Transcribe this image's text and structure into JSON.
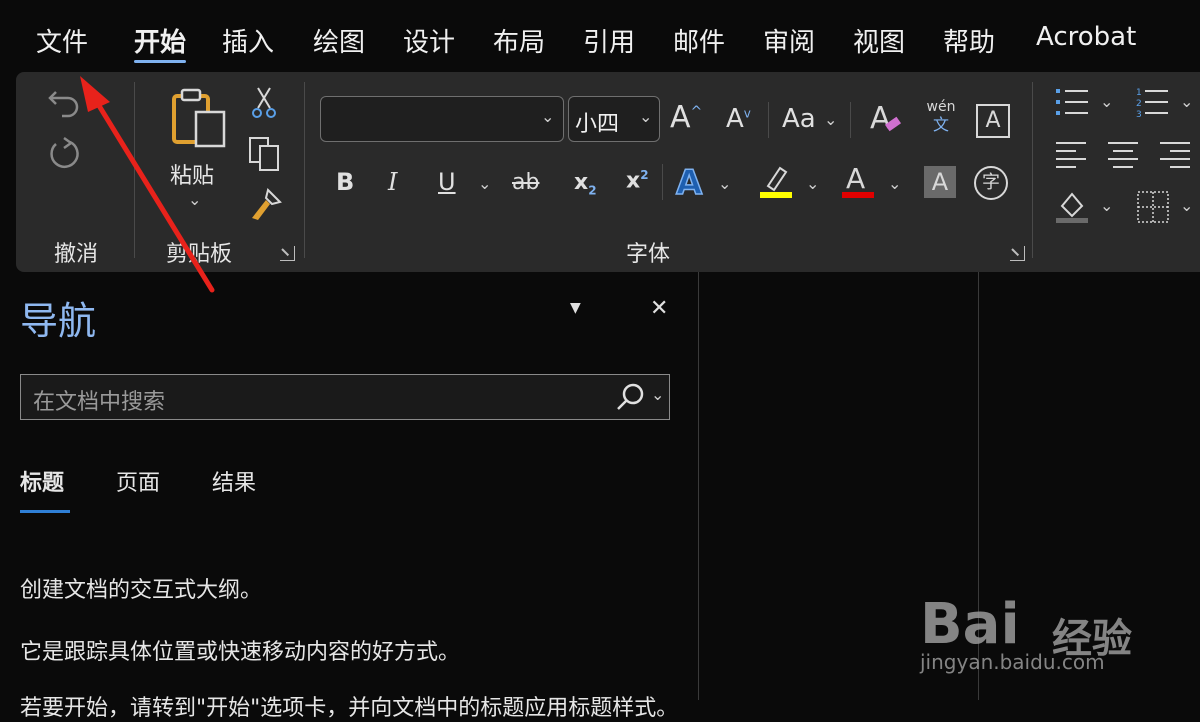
{
  "menu": {
    "tabs": [
      "文件",
      "开始",
      "插入",
      "绘图",
      "设计",
      "布局",
      "引用",
      "邮件",
      "审阅",
      "视图",
      "帮助",
      "Acrobat"
    ],
    "active_index": 1
  },
  "ribbon": {
    "groups": {
      "undo": {
        "label": "撤消"
      },
      "clipboard": {
        "label": "剪贴板",
        "paste_label": "粘贴"
      },
      "font": {
        "label": "字体",
        "font_name": "",
        "font_size": "小四"
      }
    },
    "phonetic": {
      "top": "wén",
      "bottom": "文"
    },
    "colors": {
      "highlight": "#ffff00",
      "font_color": "#e00000",
      "accent": "#7fb2f0"
    }
  },
  "nav": {
    "title": "导航",
    "search_placeholder": "在文档中搜索",
    "tabs": [
      "标题",
      "页面",
      "结果"
    ],
    "active_tab": 0,
    "paragraphs": [
      "创建文档的交互式大纲。",
      "它是跟踪具体位置或快速移动内容的好方式。",
      "若要开始，请转到\"开始\"选项卡，并向文档中的标题应用标题样式。"
    ]
  },
  "watermark": {
    "brand": "Bai",
    "brand_cn": "经验",
    "url": "jingyan.baidu.com"
  }
}
